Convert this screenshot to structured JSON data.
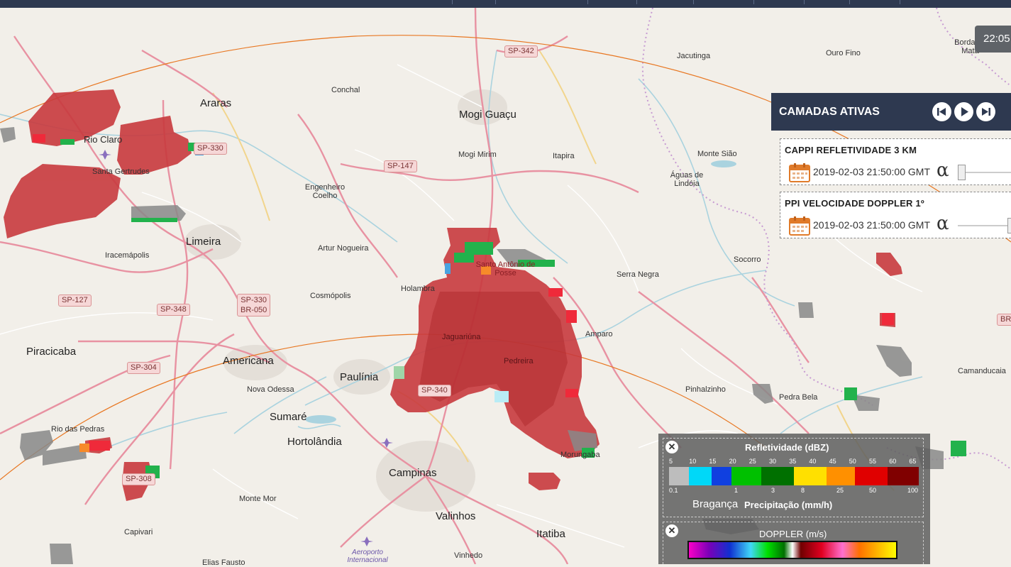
{
  "clock": "22:05",
  "layers_panel": {
    "title": "CAMADAS ATIVAS",
    "layers": [
      {
        "name": "CAPPI REFLETIVIDADE 3 KM",
        "date": "2019-02-03 21:50:00 GMT",
        "alpha_symbol": "α"
      },
      {
        "name": "PPI VELOCIDADE DOPPLER 1º",
        "date": "2019-02-03 21:50:00 GMT",
        "alpha_symbol": "α"
      }
    ],
    "icons": [
      "skip-back-icon",
      "play-icon",
      "skip-forward-icon",
      "calendar-icon",
      "alpha-icon"
    ]
  },
  "legend": {
    "reflectivity": {
      "title": "Refletividade (dBZ)",
      "dbz_ticks": [
        "5",
        "10",
        "15",
        "20",
        "25",
        "30",
        "35",
        "40",
        "45",
        "50",
        "55",
        "60",
        "65"
      ],
      "rain_ticks": [
        "0.1",
        "1",
        "3",
        "8",
        "25",
        "50",
        "100"
      ],
      "subtitle": "Precipitação (mm/h)"
    },
    "doppler": {
      "title": "DOPPLER (m/s)"
    },
    "colors": {
      "refl_gray": "#bdbdbd",
      "refl_cyan": "#00d8f8",
      "refl_blue": "#1040e0",
      "refl_green": "#00c000",
      "refl_darkgreen": "#007000",
      "refl_yellow": "#ffe000",
      "refl_orange": "#ff9000",
      "refl_red": "#e00000",
      "refl_darkred": "#800000"
    }
  },
  "map": {
    "places": [
      {
        "name": "Araras",
        "size": "big"
      },
      {
        "name": "Rio Claro",
        "size": "big"
      },
      {
        "name": "Santa Gertrudes",
        "size": "small"
      },
      {
        "name": "Conchal",
        "size": "small"
      },
      {
        "name": "Mogi Guaçu",
        "size": "big"
      },
      {
        "name": "Mogi Mirim",
        "size": "small"
      },
      {
        "name": "Itapira",
        "size": "small"
      },
      {
        "name": "Jacutinga",
        "size": "small"
      },
      {
        "name": "Ouro Fino",
        "size": "small"
      },
      {
        "name": "Borda da Mata",
        "size": "small"
      },
      {
        "name": "Monte Sião",
        "size": "small"
      },
      {
        "name": "Águas de Lindóia",
        "size": "small"
      },
      {
        "name": "Engenheiro Coelho",
        "size": "small"
      },
      {
        "name": "Limeira",
        "size": "big"
      },
      {
        "name": "Iracemápolis",
        "size": "small"
      },
      {
        "name": "Artur Nogueira",
        "size": "small"
      },
      {
        "name": "Santo Antônio de Posse",
        "size": "small"
      },
      {
        "name": "Holambra",
        "size": "small"
      },
      {
        "name": "Cosmópolis",
        "size": "small"
      },
      {
        "name": "Serra Negra",
        "size": "small"
      },
      {
        "name": "Socorro",
        "size": "small"
      },
      {
        "name": "Amparo",
        "size": "small"
      },
      {
        "name": "Jaguariúna",
        "size": "small"
      },
      {
        "name": "Pedreira",
        "size": "small"
      },
      {
        "name": "Piracicaba",
        "size": "big"
      },
      {
        "name": "Americana",
        "size": "big"
      },
      {
        "name": "Nova Odessa",
        "size": "small"
      },
      {
        "name": "Paulínia",
        "size": "big"
      },
      {
        "name": "Sumaré",
        "size": "big"
      },
      {
        "name": "Hortolândia",
        "size": "big"
      },
      {
        "name": "Campinas",
        "size": "big"
      },
      {
        "name": "Valinhos",
        "size": "big"
      },
      {
        "name": "Itatiba",
        "size": "big"
      },
      {
        "name": "Vinhedo",
        "size": "small"
      },
      {
        "name": "Morungaba",
        "size": "small"
      },
      {
        "name": "Pinhalzinho",
        "size": "small"
      },
      {
        "name": "Pedra Bela",
        "size": "small"
      },
      {
        "name": "Camanducaia",
        "size": "small"
      },
      {
        "name": "Bragança",
        "size": "big"
      },
      {
        "name": "Rio das Pedras",
        "size": "small"
      },
      {
        "name": "Monte Mor",
        "size": "small"
      },
      {
        "name": "Capivari",
        "size": "small"
      },
      {
        "name": "Elias Fausto",
        "size": "small"
      },
      {
        "name": "Aeroporto Internacional",
        "size": "small"
      }
    ],
    "shields": [
      "SP-342",
      "SP-330",
      "SP-147",
      "SP-127",
      "SP-348",
      "SP-330",
      "BR-050",
      "SP-304",
      "SP-340",
      "SP-308",
      "BR"
    ]
  }
}
